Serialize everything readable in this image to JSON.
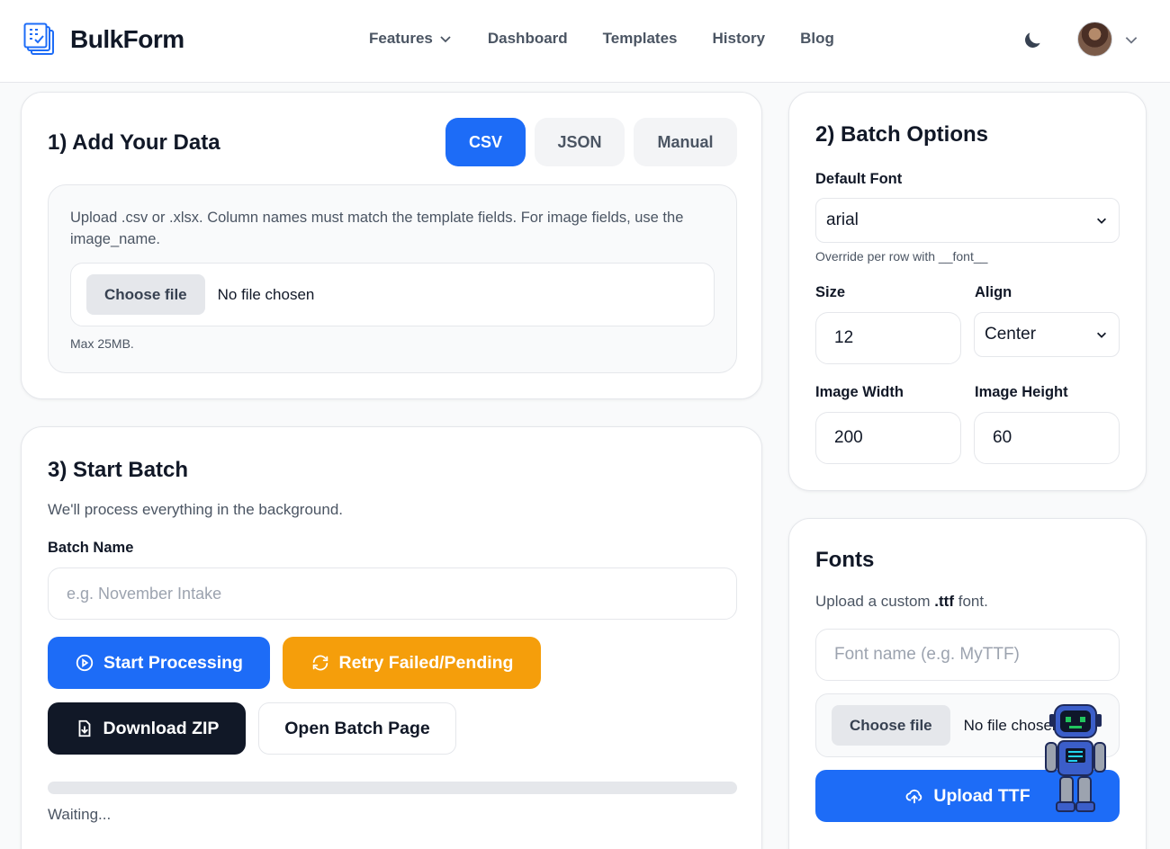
{
  "header": {
    "logo_text": "BulkForm",
    "nav": [
      {
        "label": "Features",
        "has_dropdown": true
      },
      {
        "label": "Dashboard"
      },
      {
        "label": "Templates"
      },
      {
        "label": "History"
      },
      {
        "label": "Blog"
      }
    ],
    "theme_icon": "moon-icon",
    "avatar_icon": "user-avatar",
    "avatar_chevron_icon": "chevron-down-icon"
  },
  "add_data": {
    "title": "1) Add Your Data",
    "tabs": [
      {
        "label": "CSV",
        "active": true
      },
      {
        "label": "JSON",
        "active": false
      },
      {
        "label": "Manual",
        "active": false
      }
    ],
    "description": "Upload .csv or .xlsx. Column names must match the template fields. For image fields, use the image_name.",
    "file_button": "Choose file",
    "file_status": "No file chosen",
    "max_note": "Max 25MB."
  },
  "batch_options": {
    "title": "2) Batch Options",
    "default_font_label": "Default Font",
    "default_font_value": "arial",
    "default_font_hint": "Override per row with __font__",
    "size_label": "Size",
    "size_value": "12",
    "align_label": "Align",
    "align_value": "Center",
    "width_label": "Image Width",
    "width_value": "200",
    "height_label": "Image Height",
    "height_value": "60"
  },
  "start_batch": {
    "title": "3) Start Batch",
    "subtitle": "We'll process everything in the background.",
    "batch_name_label": "Batch Name",
    "batch_name_placeholder": "e.g. November Intake",
    "start_button": "Start Processing",
    "retry_button": "Retry Failed/Pending",
    "download_button": "Download ZIP",
    "open_button": "Open Batch Page",
    "progress_fraction": 0,
    "status": "Waiting..."
  },
  "fonts": {
    "title": "Fonts",
    "subtitle_prefix": "Upload a custom ",
    "subtitle_ext": ".ttf",
    "subtitle_suffix": " font.",
    "font_name_placeholder": "Font name (e.g. MyTTF)",
    "file_button": "Choose file",
    "file_status": "No file chosen",
    "upload_button": "Upload TTF"
  },
  "colors": {
    "primary": "#1d6cf7",
    "warning": "#f59e0b",
    "dark": "#111827"
  }
}
